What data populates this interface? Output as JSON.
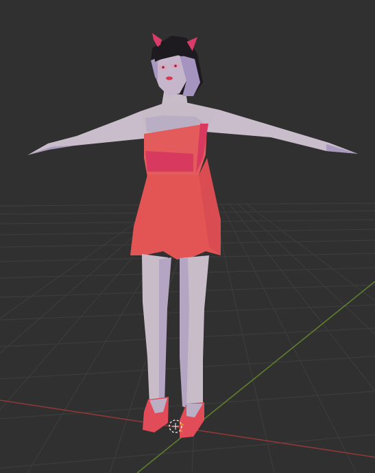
{
  "viewport": {
    "background_color": "#303030",
    "grid_line_color": "#3d3d3d",
    "x_axis_color": "#9a3a3a",
    "y_axis_color": "#6a8a2e"
  },
  "model": {
    "skin_color": "#c8bcc8",
    "skin_shadow_color": "#a99bc0",
    "hair_color": "#1c1a1f",
    "horn_color": "#d93b6a",
    "dress_color": "#e35757",
    "dress_dark_color": "#d8395f",
    "shoe_color": "#e24b58"
  },
  "icons": {
    "object_origin": "origin-pivot-icon",
    "cursor_3d": "3d-cursor-icon"
  }
}
